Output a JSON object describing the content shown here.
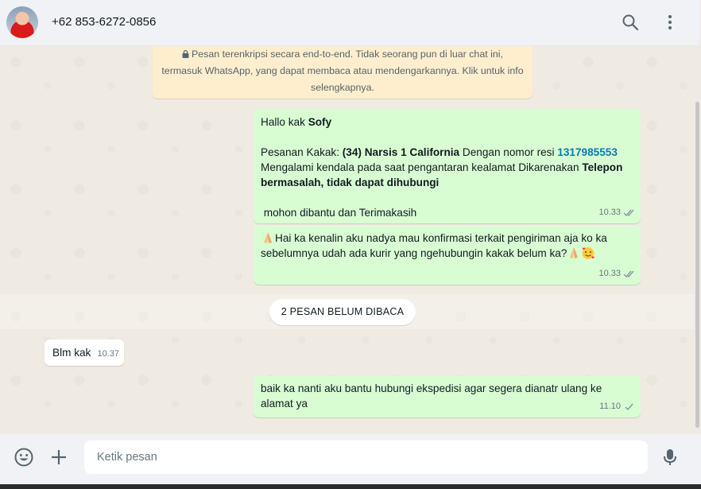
{
  "header": {
    "contact_name": "+62 853-6272-0856",
    "search_icon": "search-icon",
    "menu_icon": "more-vertical-icon"
  },
  "encryption_notice": {
    "line1": "Pesan terenkripsi secara end-to-end. Tidak seorang pun di luar chat ini,",
    "line2": "termasuk WhatsApp, yang dapat membaca atau mendengarkannya. Klik untuk info",
    "line3": "selengkapnya."
  },
  "messages": [
    {
      "greeting_prefix": "Hallo kak ",
      "greeting_name": "Sofy",
      "order_prefix": "Pesanan Kakak: ",
      "order_item": "(34) Narsis 1 California",
      "order_mid": " Dengan nomor resi ",
      "tracking_number": "1317985553",
      "issue_prefix": "Mengalami kendala pada saat pengantaran kealamat Dikarenakan ",
      "issue_reason": "Telepon bermasalah, tidak dapat dihubungi",
      "closing": " mohon dibantu dan Terimakasih",
      "time": "10.33",
      "status": "delivered"
    },
    {
      "text": "Hai ka kenalin aku nadya mau konfirmasi terkait pengiriman aja ko ka sebelumnya udah ada kurir yang ngehubungin kakak belum ka?",
      "time": "10.33",
      "status": "delivered"
    },
    {
      "text": "Blm kak",
      "time": "10.37",
      "direction": "incoming"
    },
    {
      "text": "baik ka nanti aku bantu hubungi ekspedisi agar segera dianatr ulang ke alamat ya",
      "time": "11.10",
      "status": "sent"
    }
  ],
  "unread_divider": "2 PESAN BELUM DIBACA",
  "footer": {
    "input_placeholder": "Ketik pesan",
    "emoji_icon": "emoji-icon",
    "attach_icon": "plus-icon",
    "mic_icon": "microphone-icon"
  },
  "colors": {
    "outgoing_bubble": "#d9fdd3",
    "incoming_bubble": "#ffffff",
    "chat_bg": "#efeae2",
    "link": "#027eb5",
    "notice_bg": "#ffeecd"
  }
}
